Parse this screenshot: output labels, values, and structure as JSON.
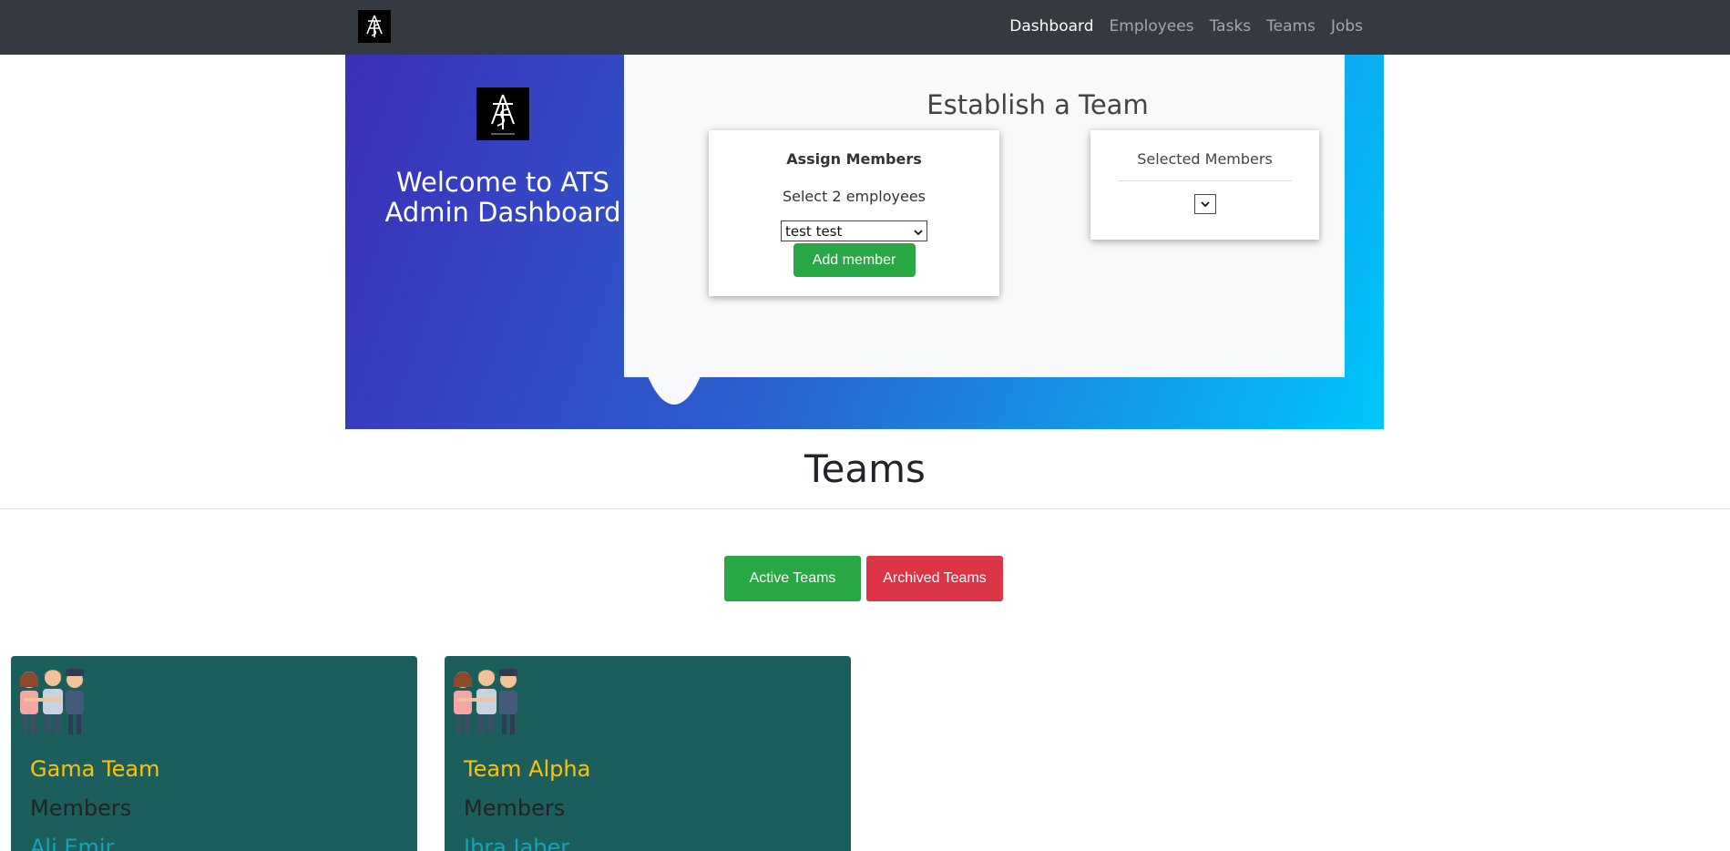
{
  "nav": {
    "links": [
      "Dashboard",
      "Employees",
      "Tasks",
      "Teams",
      "Jobs"
    ],
    "active": "Dashboard"
  },
  "hero": {
    "welcome": "Welcome to ATS Admin Dashboard",
    "establish_title": "Establish a Team",
    "assign": {
      "title": "Assign Members",
      "subtitle": "Select 2 employees",
      "selected_employee": "test test",
      "add_button": "Add member"
    },
    "selected": {
      "title": "Selected Members"
    }
  },
  "teams": {
    "heading": "Teams",
    "active_button": "Active Teams",
    "archived_button": "Archived Teams",
    "cards": [
      {
        "name": "Gama Team",
        "members_label": "Members",
        "first_member": "Ali Emir"
      },
      {
        "name": "Team Alpha",
        "members_label": "Members",
        "first_member": "Ibra Jaber"
      }
    ]
  },
  "colors": {
    "navbar": "#343a40",
    "success": "#28a745",
    "danger": "#dc3545",
    "team_card": "#1b5e5c",
    "team_name": "#ffc107",
    "member_link": "#17a2b8"
  }
}
